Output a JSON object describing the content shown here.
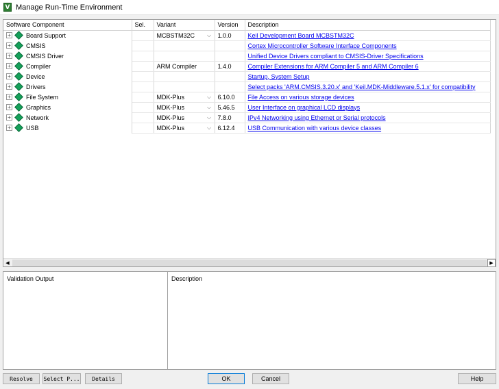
{
  "window": {
    "title": "Manage Run-Time Environment",
    "icon": "V"
  },
  "grid": {
    "headers": {
      "component": "Software Component",
      "sel": "Sel.",
      "variant": "Variant",
      "version": "Version",
      "description": "Description"
    },
    "rows": [
      {
        "component": "Board Support",
        "variant": "MCBSTM32C",
        "has_dropdown": true,
        "version": "1.0.0",
        "description": "Keil Development Board MCBSTM32C"
      },
      {
        "component": "CMSIS",
        "variant": "",
        "has_dropdown": false,
        "version": "",
        "description": "Cortex Microcontroller Software Interface Components"
      },
      {
        "component": "CMSIS Driver",
        "variant": "",
        "has_dropdown": false,
        "version": "",
        "description": "Unified Device Drivers compliant to CMSIS-Driver Specifications"
      },
      {
        "component": "Compiler",
        "variant": "ARM Compiler",
        "has_dropdown": false,
        "version": "1.4.0",
        "description": "Compiler Extensions for ARM Compiler 5 and ARM Compiler 6"
      },
      {
        "component": "Device",
        "variant": "",
        "has_dropdown": false,
        "version": "",
        "description": "Startup, System Setup"
      },
      {
        "component": "Drivers",
        "variant": "",
        "has_dropdown": false,
        "version": "",
        "description": "Select packs 'ARM.CMSIS.3.20.x' and 'Keil.MDK-Middleware.5.1.x' for compatibility"
      },
      {
        "component": "File System",
        "variant": "MDK-Plus",
        "has_dropdown": true,
        "version": "6.10.0",
        "description": "File Access on various storage devices"
      },
      {
        "component": "Graphics",
        "variant": "MDK-Plus",
        "has_dropdown": true,
        "version": "5.46.5",
        "description": "User Interface on graphical LCD displays"
      },
      {
        "component": "Network",
        "variant": "MDK-Plus",
        "has_dropdown": true,
        "version": "7.8.0",
        "description": "IPv4 Networking using Ethernet or Serial protocols"
      },
      {
        "component": "USB",
        "variant": "MDK-Plus",
        "has_dropdown": true,
        "version": "6.12.4",
        "description": "USB Communication with various device classes"
      }
    ],
    "expander_glyph": "+",
    "dropdown_glyph": "⌵",
    "scroll_left_glyph": "◀",
    "scroll_right_glyph": "▶",
    "component_icon": "green-diamond-icon",
    "component_icon_color": "#14a05a",
    "link_color": "#0000ee"
  },
  "lower": {
    "validation_label": "Validation Output",
    "description_label": "Description"
  },
  "buttons": {
    "resolve": "Resolve",
    "select_packs": "Select P...",
    "details": "Details",
    "ok": "OK",
    "cancel": "Cancel",
    "help": "Help"
  }
}
